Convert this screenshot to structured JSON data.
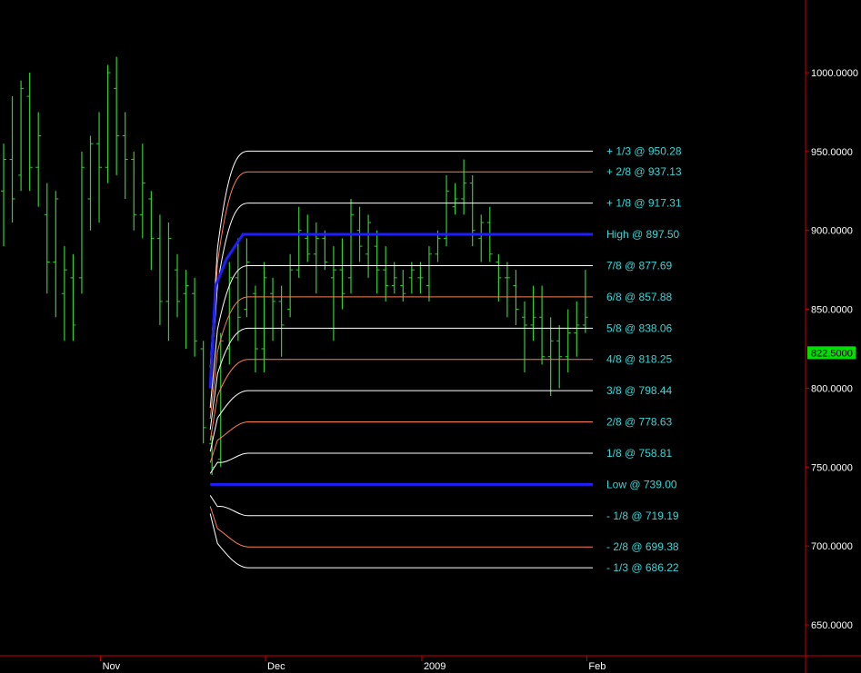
{
  "chart_data": {
    "type": "ohlc",
    "y_axis": {
      "ticks": [
        "1000.0000",
        "950.0000",
        "900.0000",
        "850.0000",
        "800.0000",
        "750.0000",
        "700.0000",
        "650.0000"
      ],
      "tick_values": [
        1000,
        950,
        900,
        850,
        800,
        750,
        700,
        650
      ],
      "range": [
        620,
        1040
      ]
    },
    "x_axis": {
      "labels": [
        "Nov",
        "Dec",
        "2009",
        "Feb"
      ],
      "label_bars": [
        12,
        31,
        49,
        68
      ],
      "bar_count": 68
    },
    "current_price": {
      "label": "822.5000",
      "value": 822.5,
      "color": "#00e000"
    },
    "levels": [
      {
        "label": "+ 1/3 @ 950.28",
        "value": 950.28,
        "color": "#ffffff",
        "kind": "thin"
      },
      {
        "label": "+ 2/8 @ 937.13",
        "value": 937.13,
        "color": "#ff7f50",
        "kind": "thin"
      },
      {
        "label": "+ 1/8 @ 917.31",
        "value": 917.31,
        "color": "#ffffff",
        "kind": "thin"
      },
      {
        "label": "High @ 897.50",
        "value": 897.5,
        "color": "#1e1eff",
        "kind": "thick"
      },
      {
        "label": "7/8 @ 877.69",
        "value": 877.69,
        "color": "#ffffff",
        "kind": "thin"
      },
      {
        "label": "6/8 @ 857.88",
        "value": 857.88,
        "color": "#ff7f50",
        "kind": "thin"
      },
      {
        "label": "5/8 @ 838.06",
        "value": 838.06,
        "color": "#ffffff",
        "kind": "thin"
      },
      {
        "label": "4/8 @ 818.25",
        "value": 818.25,
        "color": "#ff7f50",
        "kind": "thin"
      },
      {
        "label": "3/8 @ 798.44",
        "value": 798.44,
        "color": "#ffffff",
        "kind": "thin"
      },
      {
        "label": "2/8 @ 778.63",
        "value": 778.63,
        "color": "#ff7f50",
        "kind": "thin"
      },
      {
        "label": "1/8 @ 758.81",
        "value": 758.81,
        "color": "#ffffff",
        "kind": "thin"
      },
      {
        "label": "Low @ 739.00",
        "value": 739.0,
        "color": "#1e1eff",
        "kind": "thick"
      },
      {
        "label": "- 1/8 @ 719.19",
        "value": 719.19,
        "color": "#ffffff",
        "kind": "thin"
      },
      {
        "label": "- 2/8 @ 699.38",
        "value": 699.38,
        "color": "#ff7f50",
        "kind": "thin"
      },
      {
        "label": "- 1/3 @ 686.22",
        "value": 686.22,
        "color": "#ffffff",
        "kind": "thin"
      }
    ],
    "levels_start_bar": 24,
    "levels_end_bar": 67,
    "bar_color": "#33cc33",
    "bars": [
      {
        "h": 955,
        "l": 890,
        "o": 925,
        "c": 945
      },
      {
        "h": 985,
        "l": 905,
        "o": 945,
        "c": 920
      },
      {
        "h": 995,
        "l": 925,
        "o": 935,
        "c": 990
      },
      {
        "h": 1000,
        "l": 925,
        "o": 985,
        "c": 940
      },
      {
        "h": 975,
        "l": 915,
        "o": 940,
        "c": 960
      },
      {
        "h": 930,
        "l": 860,
        "o": 910,
        "c": 880
      },
      {
        "h": 925,
        "l": 845,
        "o": 880,
        "c": 920
      },
      {
        "h": 890,
        "l": 830,
        "o": 860,
        "c": 875
      },
      {
        "h": 885,
        "l": 830,
        "o": 870,
        "c": 840
      },
      {
        "h": 950,
        "l": 860,
        "o": 870,
        "c": 940
      },
      {
        "h": 960,
        "l": 900,
        "o": 920,
        "c": 955
      },
      {
        "h": 975,
        "l": 905,
        "o": 955,
        "c": 940
      },
      {
        "h": 1005,
        "l": 930,
        "o": 940,
        "c": 1000
      },
      {
        "h": 1010,
        "l": 935,
        "o": 990,
        "c": 960
      },
      {
        "h": 975,
        "l": 920,
        "o": 960,
        "c": 945
      },
      {
        "h": 950,
        "l": 900,
        "o": 945,
        "c": 910
      },
      {
        "h": 955,
        "l": 895,
        "o": 910,
        "c": 930
      },
      {
        "h": 925,
        "l": 875,
        "o": 920,
        "c": 895
      },
      {
        "h": 910,
        "l": 840,
        "o": 895,
        "c": 855
      },
      {
        "h": 905,
        "l": 830,
        "o": 855,
        "c": 895
      },
      {
        "h": 885,
        "l": 845,
        "o": 875,
        "c": 855
      },
      {
        "h": 875,
        "l": 825,
        "o": 860,
        "c": 865
      },
      {
        "h": 870,
        "l": 820,
        "o": 860,
        "c": 830
      },
      {
        "h": 830,
        "l": 765,
        "o": 825,
        "c": 775
      },
      {
        "h": 770,
        "l": 745,
        "o": 765,
        "c": 750
      },
      {
        "h": 835,
        "l": 750,
        "o": 755,
        "c": 830
      },
      {
        "h": 880,
        "l": 815,
        "o": 825,
        "c": 870
      },
      {
        "h": 895,
        "l": 830,
        "o": 870,
        "c": 845
      },
      {
        "h": 895,
        "l": 845,
        "o": 850,
        "c": 880
      },
      {
        "h": 865,
        "l": 810,
        "o": 860,
        "c": 825
      },
      {
        "h": 880,
        "l": 810,
        "o": 825,
        "c": 870
      },
      {
        "h": 870,
        "l": 830,
        "o": 860,
        "c": 855
      },
      {
        "h": 865,
        "l": 820,
        "o": 855,
        "c": 840
      },
      {
        "h": 885,
        "l": 845,
        "o": 850,
        "c": 875
      },
      {
        "h": 915,
        "l": 870,
        "o": 875,
        "c": 900
      },
      {
        "h": 910,
        "l": 880,
        "o": 895,
        "c": 885
      },
      {
        "h": 905,
        "l": 860,
        "o": 885,
        "c": 895
      },
      {
        "h": 900,
        "l": 875,
        "o": 895,
        "c": 880
      },
      {
        "h": 890,
        "l": 830,
        "o": 870,
        "c": 875
      },
      {
        "h": 895,
        "l": 850,
        "o": 875,
        "c": 860
      },
      {
        "h": 920,
        "l": 860,
        "o": 870,
        "c": 910
      },
      {
        "h": 915,
        "l": 880,
        "o": 900,
        "c": 890
      },
      {
        "h": 910,
        "l": 870,
        "o": 885,
        "c": 905
      },
      {
        "h": 900,
        "l": 860,
        "o": 890,
        "c": 875
      },
      {
        "h": 890,
        "l": 855,
        "o": 875,
        "c": 865
      },
      {
        "h": 880,
        "l": 860,
        "o": 865,
        "c": 870
      },
      {
        "h": 875,
        "l": 855,
        "o": 865,
        "c": 860
      },
      {
        "h": 880,
        "l": 860,
        "o": 870,
        "c": 875
      },
      {
        "h": 880,
        "l": 860,
        "o": 870,
        "c": 870
      },
      {
        "h": 890,
        "l": 855,
        "o": 865,
        "c": 885
      },
      {
        "h": 900,
        "l": 880,
        "o": 885,
        "c": 895
      },
      {
        "h": 935,
        "l": 890,
        "o": 895,
        "c": 925
      },
      {
        "h": 930,
        "l": 910,
        "o": 915,
        "c": 920
      },
      {
        "h": 945,
        "l": 910,
        "o": 920,
        "c": 930
      },
      {
        "h": 935,
        "l": 890,
        "o": 930,
        "c": 900
      },
      {
        "h": 910,
        "l": 880,
        "o": 895,
        "c": 905
      },
      {
        "h": 915,
        "l": 880,
        "o": 905,
        "c": 885
      },
      {
        "h": 885,
        "l": 855,
        "o": 880,
        "c": 870
      },
      {
        "h": 880,
        "l": 845,
        "o": 870,
        "c": 870
      },
      {
        "h": 875,
        "l": 840,
        "o": 865,
        "c": 850
      },
      {
        "h": 855,
        "l": 810,
        "o": 845,
        "c": 840
      },
      {
        "h": 865,
        "l": 830,
        "o": 840,
        "c": 845
      },
      {
        "h": 865,
        "l": 815,
        "o": 845,
        "c": 820
      },
      {
        "h": 845,
        "l": 795,
        "o": 820,
        "c": 830
      },
      {
        "h": 840,
        "l": 800,
        "o": 830,
        "c": 820
      },
      {
        "h": 850,
        "l": 810,
        "o": 820,
        "c": 835
      },
      {
        "h": 855,
        "l": 820,
        "o": 835,
        "c": 840
      },
      {
        "h": 875,
        "l": 835,
        "o": 840,
        "c": 845
      }
    ]
  }
}
